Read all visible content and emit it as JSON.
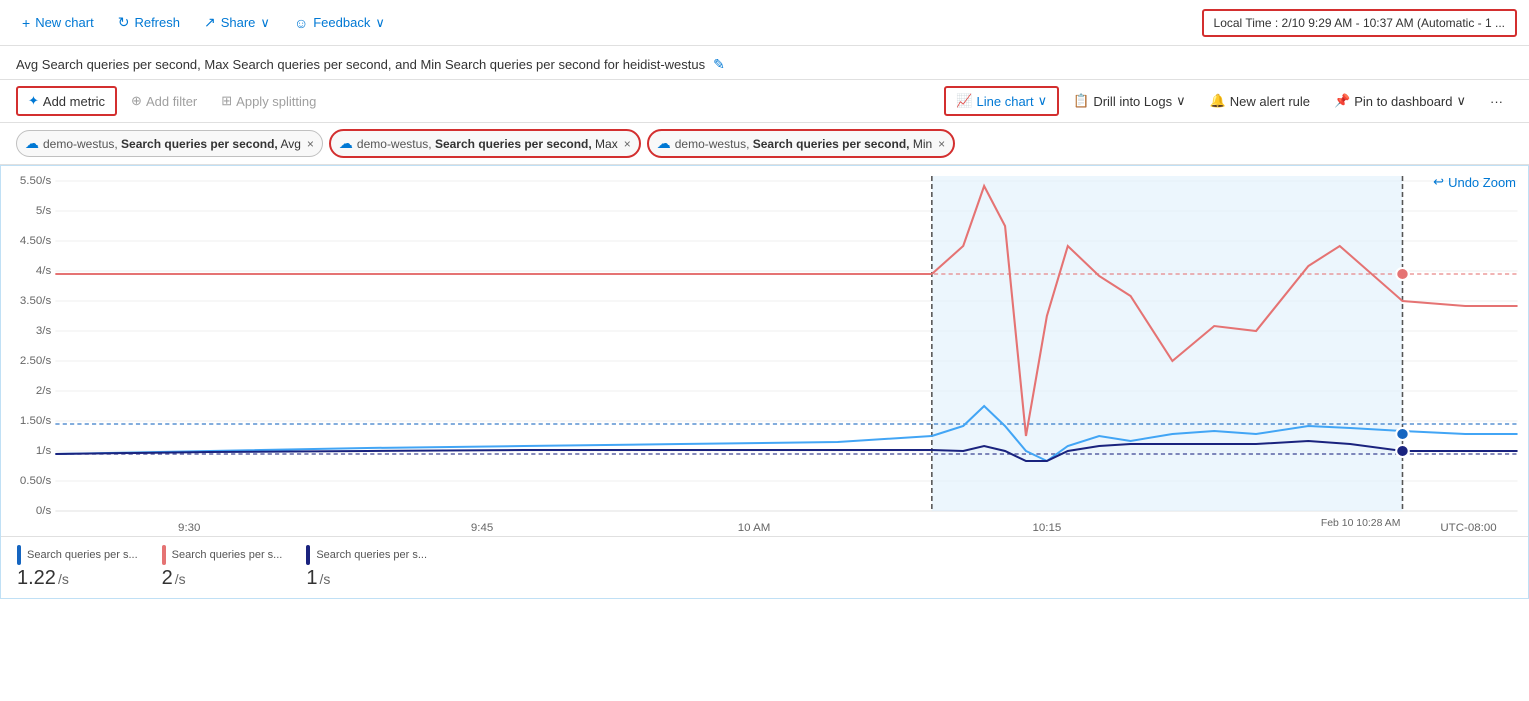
{
  "topToolbar": {
    "newChart": "New chart",
    "refresh": "Refresh",
    "share": "Share",
    "feedback": "Feedback",
    "timeSelector": "Local Time : 2/10 9:29 AM - 10:37 AM (Automatic - 1 ..."
  },
  "chartTitle": "Avg Search queries per second, Max Search queries per second, and Min Search queries per second for heidist-westus",
  "metricToolbar": {
    "addMetric": "Add metric",
    "addFilter": "Add filter",
    "applySplitting": "Apply splitting",
    "lineChart": "Line chart",
    "drillIntoLogs": "Drill into Logs",
    "newAlertRule": "New alert rule",
    "pinToDashboard": "Pin to dashboard"
  },
  "metricTags": [
    {
      "resource": "demo-westus,",
      "metric": "Search queries per second,",
      "agg": "Avg",
      "selected": false
    },
    {
      "resource": "demo-westus,",
      "metric": "Search queries per second,",
      "agg": "Max",
      "selected": true
    },
    {
      "resource": "demo-westus,",
      "metric": "Search queries per second,",
      "agg": "Min",
      "selected": true
    }
  ],
  "chart": {
    "undoZoom": "Undo Zoom",
    "yAxisLabels": [
      "5.50/s",
      "5/s",
      "4.50/s",
      "4/s",
      "3.50/s",
      "3/s",
      "2.50/s",
      "2/s",
      "1.50/s",
      "1/s",
      "0.50/s",
      "0/s"
    ],
    "xAxisLabels": [
      "9:30",
      "9:45",
      "10 AM",
      "10:15",
      "Feb 10  10:28 AM",
      "UTC-08:00"
    ]
  },
  "legend": [
    {
      "color": "#1565c0",
      "label": "Search queries per s...",
      "value": "1.22",
      "unit": "/s"
    },
    {
      "color": "#e57373",
      "label": "Search queries per s...",
      "value": "2",
      "unit": "/s"
    },
    {
      "color": "#1a237e",
      "label": "Search queries per s...",
      "value": "1",
      "unit": "/s"
    }
  ],
  "icons": {
    "plus": "+",
    "refresh": "↻",
    "share": "↗",
    "feedback": "☺",
    "chevronDown": "∨",
    "edit": "✎",
    "addMetric": "✦",
    "addFilter": "⊕",
    "splitting": "⊞",
    "lineChart": "📈",
    "drillLogs": "📋",
    "alertRule": "🔔",
    "pin": "📌",
    "more": "···",
    "close": "×",
    "cloud": "☁",
    "undoZoom": "↩",
    "navLeft": "❮",
    "navRight": "❯"
  }
}
